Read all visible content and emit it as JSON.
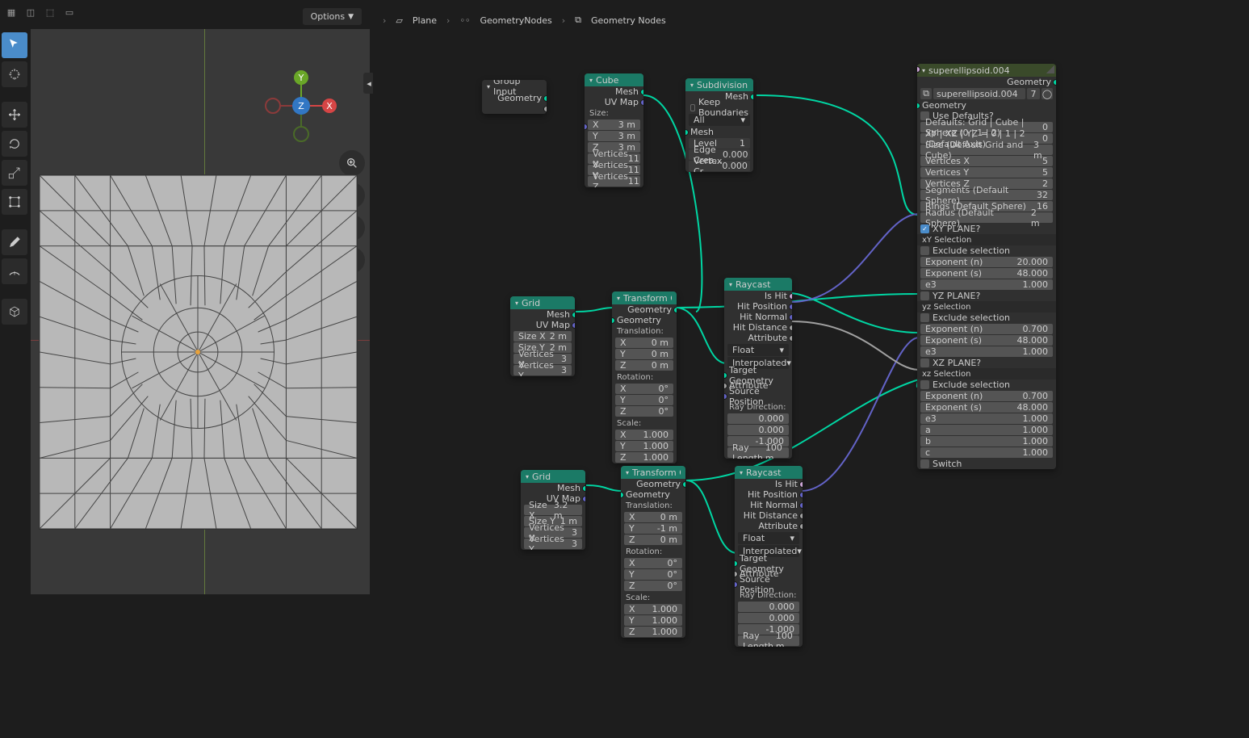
{
  "header": {
    "options": "Options"
  },
  "breadcrumb": {
    "a": "Plane",
    "b": "GeometryNodes",
    "c": "Geometry Nodes"
  },
  "axis": {
    "x": "X",
    "y": "Y",
    "z": "Z"
  },
  "nodes": {
    "groupInput": {
      "title": "Group Input",
      "out0": "Geometry"
    },
    "cube": {
      "title": "Cube",
      "mesh": "Mesh",
      "uv": "UV Map",
      "size": "Size:",
      "x": "X",
      "xv": "3 m",
      "y": "Y",
      "yv": "3 m",
      "z": "Z",
      "zv": "3 m",
      "vx": "Vertices X",
      "vxv": "11",
      "vy": "Vertices Y",
      "vyv": "11",
      "vz": "Vertices Z",
      "vzv": "11"
    },
    "subdiv": {
      "title": "Subdivision Surface",
      "mesh": "Mesh",
      "meshin": "Mesh",
      "keep": "Keep Boundaries",
      "all": "All",
      "level": "Level",
      "levelv": "1",
      "ec": "Edge Crea...",
      "ecv": "0.000",
      "vc": "Vertex Cr...",
      "vcv": "0.000"
    },
    "grid1": {
      "title": "Grid",
      "mesh": "Mesh",
      "uv": "UV Map",
      "sx": "Size X",
      "sxv": "2 m",
      "sy": "Size Y",
      "syv": "2 m",
      "vx": "Vertices X",
      "vxv": "3",
      "vy": "Vertices Y",
      "vyv": "3"
    },
    "grid2": {
      "title": "Grid",
      "mesh": "Mesh",
      "uv": "UV Map",
      "sx": "Size X",
      "sxv": "3.2 m",
      "sy": "Size Y",
      "syv": "1 m",
      "vx": "Vertices X",
      "vxv": "3",
      "vy": "Vertices Y",
      "vyv": "3"
    },
    "transform1": {
      "title": "Transform Geometry",
      "geoOut": "Geometry",
      "geoIn": "Geometry",
      "trans": "Translation:",
      "rot": "Rotation:",
      "scale": "Scale:",
      "x": "X",
      "y": "Y",
      "z": "Z",
      "tx": "0 m",
      "ty": "0 m",
      "tz": "0 m",
      "rx": "0°",
      "ry": "0°",
      "rz": "0°",
      "sx": "1.000",
      "sy": "1.000",
      "sz": "1.000"
    },
    "transform2": {
      "title": "Transform Geometry",
      "geoOut": "Geometry",
      "geoIn": "Geometry",
      "trans": "Translation:",
      "rot": "Rotation:",
      "scale": "Scale:",
      "x": "X",
      "y": "Y",
      "z": "Z",
      "tx": "0 m",
      "ty": "-1 m",
      "tz": "0 m",
      "rx": "0°",
      "ry": "0°",
      "rz": "0°",
      "sx": "1.000",
      "sy": "1.000",
      "sz": "1.000"
    },
    "raycast1": {
      "title": "Raycast",
      "ishit": "Is Hit",
      "hitpos": "Hit Position",
      "hitnorm": "Hit Normal",
      "hitdist": "Hit Distance",
      "attr": "Attribute",
      "float": "Float",
      "interp": "Interpolated",
      "target": "Target Geometry",
      "attrin": "Attribute",
      "srcpos": "Source Position",
      "raydir": "Ray Direction:",
      "rd0": "0.000",
      "rd1": "0.000",
      "rd2": "-1.000",
      "raylen": "Ray Length",
      "raylenv": "100 m"
    },
    "raycast2": {
      "title": "Raycast",
      "ishit": "Is Hit",
      "hitpos": "Hit Position",
      "hitnorm": "Hit Normal",
      "hitdist": "Hit Distance",
      "attr": "Attribute",
      "float": "Float",
      "interp": "Interpolated",
      "target": "Target Geometry",
      "attrin": "Attribute",
      "srcpos": "Source Position",
      "raydir": "Ray Direction:",
      "rd0": "0.000",
      "rd1": "0.000",
      "rd2": "-1.000",
      "raylen": "Ray Length",
      "raylenv": "100 m"
    },
    "super": {
      "title": "superellipsoid.004",
      "name": "superellipsoid.004",
      "nameNum": "7",
      "geoOut": "Geometry",
      "geoIn": "Geometry",
      "usedef": "Use Defaults?",
      "defaults": "Defaults: Grid | Cube | Sphere (0 | 1 | 2)",
      "defaultsv": "0",
      "axis": "XY | XZ | YZ = 0 | 1 | 2 (Default Axis)",
      "axisv": "0",
      "size": "Size (Default Grid and Cube)",
      "sizev": "3 m",
      "vx": "Vertices X",
      "vxv": "5",
      "vy": "Vertices Y",
      "vyv": "5",
      "vz": "Vertices Z",
      "vzv": "2",
      "seg": "Segments (Default Sphere)",
      "segv": "32",
      "rings": "Rings (Default Sphere)",
      "ringsv": "16",
      "radius": "Radius (Default Sphere)",
      "radiusv": "2 m",
      "xyplane": "XY PLANE?",
      "xysel": "xY Selection",
      "excl": "Exclude selection",
      "expn": "Exponent (n)",
      "exps": "Exponent (s)",
      "e3": "e3",
      "yzplane": "YZ PLANE?",
      "yzsel": "yz Selection",
      "xzplane": "XZ PLANE?",
      "xzsel": "xz Selection",
      "v_xy_n": "20.000",
      "v_xy_s": "48.000",
      "v_xy_e3": "1.000",
      "v_yz_n": "0.700",
      "v_yz_s": "48.000",
      "v_yz_e3": "1.000",
      "v_xz_n": "0.700",
      "v_xz_s": "48.000",
      "v_xz_e3": "1.000",
      "a": "a",
      "av": "1.000",
      "b": "b",
      "bv": "1.000",
      "c": "c",
      "cv": "1.000",
      "switch": "Switch"
    }
  }
}
